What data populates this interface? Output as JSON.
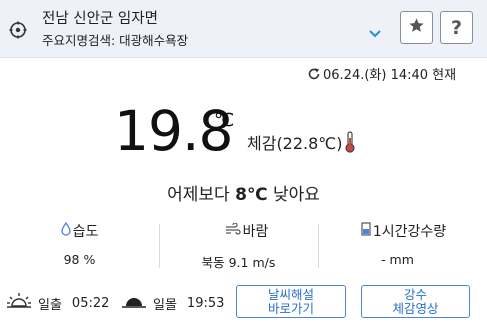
{
  "location": {
    "title": "전남 신안군 임자면",
    "subtitle": "주요지명검색: 대광해수욕장",
    "icons": {
      "locate": "crosshair-icon",
      "expand": "chevron-down-icon"
    }
  },
  "actions": {
    "favorite_icon": "star-icon",
    "help_label": "?"
  },
  "timestamp": "06.24.(화) 14:40 현재",
  "current": {
    "temperature": "19.8",
    "unit": "℃",
    "feels_like": "체감(22.8℃)"
  },
  "comparison": {
    "prefix": "어제보다",
    "value": "8℃",
    "suffix": "낮아요"
  },
  "stats": {
    "humidity": {
      "label": "습도",
      "value": "98 %"
    },
    "wind": {
      "label": "바람",
      "value": "북동 9.1 m/s"
    },
    "rain": {
      "label": "1시간강수량",
      "value": "- mm"
    }
  },
  "sun": {
    "sunrise_label": "일출",
    "sunrise_time": "05:22",
    "sunset_label": "일몰",
    "sunset_time": "19:53"
  },
  "buttons": {
    "forecast_line1": "날씨해설",
    "forecast_line2": "바로가기",
    "radar_line1": "강수",
    "radar_line2": "체감영상"
  },
  "colors": {
    "accent": "#2a6fc9",
    "location_bar": "#eef1f7",
    "thermometer": "#c94a3f",
    "drop": "#4a86d8"
  }
}
